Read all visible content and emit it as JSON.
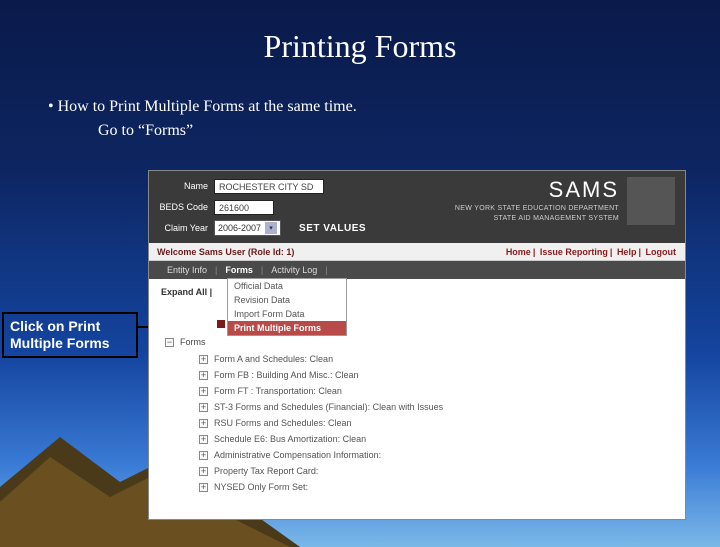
{
  "slide": {
    "title": "Printing Forms",
    "bullet_line1": "•   How to Print Multiple Forms at the same time.",
    "bullet_line2": "Go to “Forms”",
    "callout": "Click on Print Multiple Forms"
  },
  "app": {
    "fields": {
      "name_label": "Name",
      "name_value": "ROCHESTER CITY SD",
      "beds_label": "BEDS Code",
      "beds_value": "261600",
      "year_label": "Claim Year",
      "year_value": "2006-2007",
      "set_values": "SET VALUES"
    },
    "brand": {
      "title": "SAMS",
      "sub1": "NEW YORK STATE EDUCATION DEPARTMENT",
      "sub2": "STATE AID MANAGEMENT SYSTEM"
    },
    "welcome": {
      "left": "Welcome Sams User (Role Id: 1)",
      "links": [
        "Home",
        "Issue Reporting",
        "Help",
        "Logout"
      ]
    },
    "tabs": [
      "Entity Info",
      "Forms",
      "Activity Log"
    ],
    "dropdown": [
      "Official Data",
      "Revision Data",
      "Import Form Data",
      "Print Multiple Forms"
    ],
    "expand_all": "Expand All |",
    "forms_label": "Forms",
    "forms": [
      "Form A and Schedules:  Clean",
      "Form FB : Building And Misc.:  Clean",
      "Form FT : Transportation:  Clean",
      "ST-3 Forms and Schedules (Financial):  Clean with Issues",
      "RSU Forms and Schedules:  Clean",
      "Schedule E6: Bus Amortization:  Clean",
      "Administrative Compensation Information:",
      "Property Tax Report Card:",
      "NYSED Only Form Set:"
    ]
  }
}
